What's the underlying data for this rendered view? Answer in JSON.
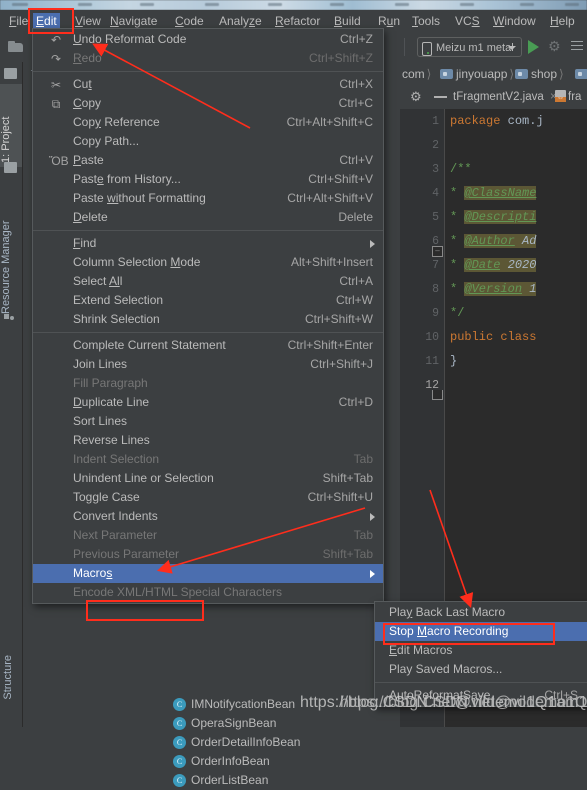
{
  "window": {
    "menubar": [
      {
        "label": "File",
        "mnemonic": "F",
        "selected": false
      },
      {
        "label": "Edit",
        "mnemonic": "E",
        "selected": true
      },
      {
        "label": "View",
        "mnemonic": "V",
        "selected": false
      },
      {
        "label": "Navigate",
        "mnemonic": "N",
        "selected": false
      },
      {
        "label": "Code",
        "mnemonic": "C",
        "selected": false
      },
      {
        "label": "Analyze",
        "mnemonic": "z",
        "selected": false
      },
      {
        "label": "Refactor",
        "mnemonic": "R",
        "selected": false
      },
      {
        "label": "Build",
        "mnemonic": "B",
        "selected": false
      },
      {
        "label": "Run",
        "mnemonic": "u",
        "selected": false
      },
      {
        "label": "Tools",
        "mnemonic": "T",
        "selected": false
      },
      {
        "label": "VCS",
        "mnemonic": "S",
        "selected": false
      },
      {
        "label": "Window",
        "mnemonic": "W",
        "selected": false
      },
      {
        "label": "Help",
        "mnemonic": "H",
        "selected": false
      }
    ]
  },
  "toolbar": {
    "device": "Meizu m1 metal",
    "open_icon": "open-folder-icon",
    "undo_icon": "undo-arrow-icon",
    "redo_icon": "redo-arrow-icon",
    "run_icon": "run-play-icon",
    "debug_icon": "debug-bug-icon",
    "more_icon": "more-options-icon"
  },
  "left_rail": {
    "tabs": [
      {
        "label": "1: Project",
        "active": true
      },
      {
        "label": "Resource Manager",
        "active": false
      }
    ],
    "bottom_tab": "Structure"
  },
  "project_tree": {
    "items": [
      {
        "label": "IMNotifycationBean",
        "icon": "class-icon"
      },
      {
        "label": "OperaSignBean",
        "icon": "class-icon"
      },
      {
        "label": "OrderDetailInfoBean",
        "icon": "class-icon"
      },
      {
        "label": "OrderInfoBean",
        "icon": "class-icon"
      },
      {
        "label": "OrderListBean",
        "icon": "class-icon"
      }
    ]
  },
  "editor": {
    "breadcrumb": [
      "com",
      "jinyouapp",
      "shop"
    ],
    "tabs": [
      {
        "label": "tFragmentV2.java",
        "close": "×",
        "active": true
      },
      {
        "label": "fra",
        "active": false
      }
    ],
    "gutter_lines": [
      "1",
      "2",
      "3",
      "4",
      "5",
      "6",
      "7",
      "8",
      "9",
      "10",
      "11",
      "12"
    ],
    "code": [
      {
        "line": "1",
        "segments": [
          {
            "t": "package",
            "c": "kw"
          },
          {
            "t": " com.j",
            "c": "id"
          }
        ]
      },
      {
        "line": "2",
        "segments": []
      },
      {
        "line": "3",
        "segments": [
          {
            "t": "/**",
            "c": "cmt"
          }
        ]
      },
      {
        "line": "4",
        "segments": [
          {
            "t": " * ",
            "c": "cmt"
          },
          {
            "t": "@ClassName",
            "c": "doc-tag"
          }
        ]
      },
      {
        "line": "5",
        "segments": [
          {
            "t": " * ",
            "c": "cmt"
          },
          {
            "t": "@Descripti",
            "c": "doc-tag"
          }
        ]
      },
      {
        "line": "6",
        "segments": [
          {
            "t": " * ",
            "c": "cmt"
          },
          {
            "t": "@Author",
            "c": "doc-tag"
          },
          {
            "t": " Ad",
            "c": "doc-txt"
          }
        ]
      },
      {
        "line": "7",
        "segments": [
          {
            "t": " * ",
            "c": "cmt"
          },
          {
            "t": "@Date",
            "c": "doc-tag"
          },
          {
            "t": " 2020",
            "c": "doc-txt"
          }
        ]
      },
      {
        "line": "8",
        "segments": [
          {
            "t": " * ",
            "c": "cmt"
          },
          {
            "t": "@Version",
            "c": "doc-tag"
          },
          {
            "t": " 1",
            "c": "doc-txt"
          }
        ]
      },
      {
        "line": "9",
        "segments": [
          {
            "t": " */",
            "c": "cmt"
          }
        ]
      },
      {
        "line": "10",
        "segments": [
          {
            "t": "public class",
            "c": "kw"
          }
        ]
      },
      {
        "line": "11",
        "segments": [
          {
            "t": "}",
            "c": "id"
          }
        ]
      },
      {
        "line": "12",
        "segments": []
      }
    ]
  },
  "edit_menu": {
    "items": [
      {
        "label": "Undo Reformat Code",
        "mnemonic": "U",
        "accel": "Ctrl+Z",
        "icon": "undo-icon",
        "state": "normal"
      },
      {
        "label": "Redo",
        "mnemonic": "R",
        "accel": "Ctrl+Shift+Z",
        "icon": "redo-icon",
        "state": "disabled"
      },
      {
        "separator": true
      },
      {
        "label": "Cut",
        "mnemonic": "t",
        "accel": "Ctrl+X",
        "icon": "scissors-icon",
        "state": "normal"
      },
      {
        "label": "Copy",
        "mnemonic": "C",
        "accel": "Ctrl+C",
        "icon": "copy-icon",
        "state": "normal"
      },
      {
        "label": "Copy Reference",
        "mnemonic": "y",
        "accel": "Ctrl+Alt+Shift+C",
        "icon": "",
        "state": "normal"
      },
      {
        "label": "Copy Path...",
        "accel": "",
        "icon": "",
        "state": "normal"
      },
      {
        "label": "Paste",
        "mnemonic": "P",
        "accel": "Ctrl+V",
        "icon": "clipboard-icon",
        "state": "normal"
      },
      {
        "label": "Paste from History...",
        "mnemonic": "e",
        "accel": "Ctrl+Shift+V",
        "icon": "",
        "state": "normal"
      },
      {
        "label": "Paste without Formatting",
        "mnemonic": "wi",
        "accel": "Ctrl+Alt+Shift+V",
        "icon": "",
        "state": "normal"
      },
      {
        "label": "Delete",
        "mnemonic": "D",
        "accel": "Delete",
        "icon": "",
        "state": "normal"
      },
      {
        "separator": true
      },
      {
        "label": "Find",
        "mnemonic": "F",
        "accel": "",
        "submenu": true,
        "icon": "",
        "state": "normal"
      },
      {
        "label": "Column Selection Mode",
        "mnemonic": "M",
        "accel": "Alt+Shift+Insert",
        "icon": "",
        "state": "normal"
      },
      {
        "label": "Select All",
        "mnemonic": "Al",
        "accel": "Ctrl+A",
        "icon": "",
        "state": "normal"
      },
      {
        "label": "Extend Selection",
        "accel": "Ctrl+W",
        "icon": "",
        "state": "normal"
      },
      {
        "label": "Shrink Selection",
        "accel": "Ctrl+Shift+W",
        "icon": "",
        "state": "normal"
      },
      {
        "separator": true
      },
      {
        "label": "Complete Current Statement",
        "accel": "Ctrl+Shift+Enter",
        "icon": "",
        "state": "normal"
      },
      {
        "label": "Join Lines",
        "accel": "Ctrl+Shift+J",
        "icon": "",
        "state": "normal"
      },
      {
        "label": "Fill Paragraph",
        "accel": "",
        "icon": "",
        "state": "disabled"
      },
      {
        "label": "Duplicate Line",
        "mnemonic": "D",
        "accel": "Ctrl+D",
        "icon": "",
        "state": "normal"
      },
      {
        "label": "Sort Lines",
        "accel": "",
        "icon": "",
        "state": "normal"
      },
      {
        "label": "Reverse Lines",
        "accel": "",
        "icon": "",
        "state": "normal"
      },
      {
        "label": "Indent Selection",
        "accel": "Tab",
        "icon": "",
        "state": "disabled"
      },
      {
        "label": "Unindent Line or Selection",
        "accel": "Shift+Tab",
        "icon": "",
        "state": "normal"
      },
      {
        "label": "Toggle Case",
        "accel": "Ctrl+Shift+U",
        "icon": "",
        "state": "normal"
      },
      {
        "label": "Convert Indents",
        "accel": "",
        "submenu": true,
        "icon": "",
        "state": "normal"
      },
      {
        "label": "Next Parameter",
        "accel": "Tab",
        "icon": "",
        "state": "disabled"
      },
      {
        "label": "Previous Parameter",
        "accel": "Shift+Tab",
        "icon": "",
        "state": "disabled"
      },
      {
        "label": "Macros",
        "mnemonic": "s",
        "accel": "",
        "submenu": true,
        "icon": "",
        "state": "highlighted"
      },
      {
        "label": "Encode XML/HTML Special Characters",
        "accel": "",
        "icon": "",
        "state": "disabled"
      }
    ]
  },
  "macros_submenu": {
    "items": [
      {
        "label": "Play Back Last Macro",
        "mnemonic": "y",
        "accel": "",
        "state": "normal"
      },
      {
        "label": "Stop Macro Recording",
        "mnemonic": "M",
        "accel": "",
        "state": "highlighted"
      },
      {
        "label": "Edit Macros",
        "mnemonic": "E",
        "accel": "",
        "state": "normal"
      },
      {
        "label": "Play Saved Macros...",
        "accel": "",
        "state": "normal"
      },
      {
        "separator": true
      },
      {
        "label": "AutoReformatSave",
        "accel": "Ctrl+S",
        "state": "normal"
      }
    ]
  },
  "annotations": {
    "boxes": [
      "edit-menu-highlight",
      "macros-item-highlight",
      "stop-macro-recording-highlight"
    ],
    "arrows": [
      "arrow-to-edit-menu",
      "arrow-to-macros-item",
      "arrow-to-stop-macro-recording"
    ],
    "color": "#ff2d1c"
  },
  "watermark": {
    "text": "https://blog.CSDN.net@vildemo1Q1am1"
  },
  "colors": {
    "background": "#3c3f41",
    "editor_background": "#2b2b2b",
    "selection": "#4b6eaf",
    "accent_red": "#ff2d1c",
    "text": "#bbbbbb",
    "disabled_text": "#777777",
    "run_green": "#499c54"
  }
}
